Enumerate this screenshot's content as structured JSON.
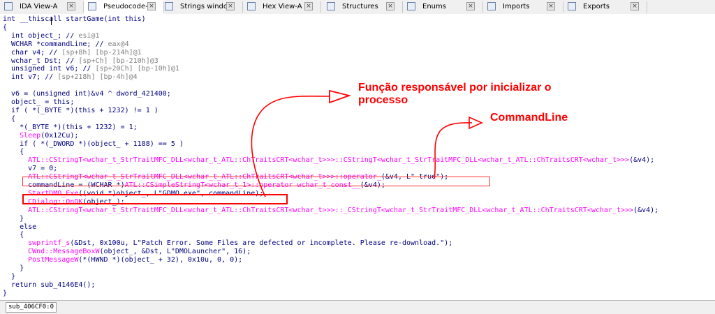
{
  "tabs": [
    {
      "label": "IDA View-A",
      "icon": "ida-view-icon"
    },
    {
      "label": "Pseudocode-A",
      "icon": "pseudocode-icon",
      "active": true
    },
    {
      "label": "Strings window",
      "icon": "strings-icon"
    },
    {
      "label": "Hex View-A",
      "icon": "hex-view-icon"
    },
    {
      "label": "Structures",
      "icon": "structures-icon"
    },
    {
      "label": "Enums",
      "icon": "enums-icon"
    },
    {
      "label": "Imports",
      "icon": "imports-icon"
    },
    {
      "label": "Exports",
      "icon": "exports-icon"
    }
  ],
  "code_lines": [
    [
      [
        "int __thiscall startGame(int this)",
        "c-id"
      ]
    ],
    [
      [
        "{",
        "c-id"
      ]
    ],
    [
      [
        "  int object_; // ",
        "c-id"
      ],
      [
        "esi@1",
        "c-cmt"
      ]
    ],
    [
      [
        "  WCHAR *commandLine; // ",
        "c-id"
      ],
      [
        "eax@4",
        "c-cmt"
      ]
    ],
    [
      [
        "  char v4; // ",
        "c-id"
      ],
      [
        "[sp+8h] [bp-214h]@1",
        "c-cmt"
      ]
    ],
    [
      [
        "  wchar_t Dst; // ",
        "c-id"
      ],
      [
        "[sp+Ch] [bp-210h]@3",
        "c-cmt"
      ]
    ],
    [
      [
        "  unsigned int v6; // ",
        "c-id"
      ],
      [
        "[sp+20Ch] [bp-10h]@1",
        "c-cmt"
      ]
    ],
    [
      [
        "  int v7; // ",
        "c-id"
      ],
      [
        "[sp+218h] [bp-4h]@4",
        "c-cmt"
      ]
    ],
    [
      [
        "",
        "c-id"
      ]
    ],
    [
      [
        "  v6 = (unsigned int)&v4 ^ dword_421400;",
        "c-id"
      ]
    ],
    [
      [
        "  object_ = this;",
        "c-id"
      ]
    ],
    [
      [
        "  if ( *(_BYTE *)(this + 1232) != 1 )",
        "c-id"
      ]
    ],
    [
      [
        "  {",
        "c-id"
      ]
    ],
    [
      [
        "    *(_BYTE *)(this + 1232) = 1;",
        "c-id"
      ]
    ],
    [
      [
        "    ",
        "c-id"
      ],
      [
        "Sleep",
        "c-api"
      ],
      [
        "(0x12Cu);",
        "c-id"
      ]
    ],
    [
      [
        "    if ( *(_DWORD *)(object_ + 1188) == 5 )",
        "c-id"
      ]
    ],
    [
      [
        "    {",
        "c-id"
      ]
    ],
    [
      [
        "      ",
        "c-id"
      ],
      [
        "ATL::CStringT<wchar_t_StrTraitMFC_DLL<wchar_t_ATL::ChTraitsCRT<wchar_t>>>::CStringT<wchar_t_StrTraitMFC_DLL<wchar_t_ATL::ChTraitsCRT<wchar_t>>>",
        "c-api"
      ],
      [
        "(&v4);",
        "c-id"
      ]
    ],
    [
      [
        "      v7 = 0;",
        "c-id"
      ]
    ],
    [
      [
        "      ",
        "c-id"
      ],
      [
        "ATL::CStringT<wchar_t_StrTraitMFC_DLL<wchar_t_ATL::ChTraitsCRT<wchar_t>>>::operator_",
        "c-api"
      ],
      [
        "(&v4, L\" true\");",
        "c-id"
      ]
    ],
    [
      [
        "      commandLine = (WCHAR *)",
        "c-id"
      ],
      [
        "ATL::CSimpleStringT<wchar_t_1>::operator wchar_t_const__",
        "c-api"
      ],
      [
        "(&v4);",
        "c-id"
      ]
    ],
    [
      [
        "      ",
        "c-id"
      ],
      [
        "StartDMO_Exe",
        "c-api"
      ],
      [
        "((void *)object_, L\"GDMO.exe\", commandLine);",
        "c-id"
      ]
    ],
    [
      [
        "      ",
        "c-id"
      ],
      [
        "CDialog::OnOK",
        "c-api"
      ],
      [
        "(object_);",
        "c-id"
      ]
    ],
    [
      [
        "      ",
        "c-id"
      ],
      [
        "ATL::CStringT<wchar_t_StrTraitMFC_DLL<wchar_t_ATL::ChTraitsCRT<wchar_t>>>::_CStringT<wchar_t_StrTraitMFC_DLL<wchar_t_ATL::ChTraitsCRT<wchar_t>>>",
        "c-api"
      ],
      [
        "(&v4);",
        "c-id"
      ]
    ],
    [
      [
        "    }",
        "c-id"
      ]
    ],
    [
      [
        "    else",
        "c-id"
      ]
    ],
    [
      [
        "    {",
        "c-id"
      ]
    ],
    [
      [
        "      ",
        "c-id"
      ],
      [
        "swprintf_s",
        "c-api"
      ],
      [
        "(&Dst, 0x100u, L\"Patch Error. Some Files are defected or incomplete. Please re-download.\");",
        "c-id"
      ]
    ],
    [
      [
        "      ",
        "c-id"
      ],
      [
        "CWnd::MessageBoxW",
        "c-api"
      ],
      [
        "(object_, &Dst, L\"DMOLauncher\", 16);",
        "c-id"
      ]
    ],
    [
      [
        "      ",
        "c-id"
      ],
      [
        "PostMessageW",
        "c-api"
      ],
      [
        "(*(HWND *)(object_ + 32), 0x10u, 0, 0);",
        "c-id"
      ]
    ],
    [
      [
        "    }",
        "c-id"
      ]
    ],
    [
      [
        "  }",
        "c-id"
      ]
    ],
    [
      [
        "  return sub_4146E4();",
        "c-id"
      ]
    ],
    [
      [
        "}",
        "c-id"
      ]
    ]
  ],
  "status": {
    "address": "sub_406CF0:0"
  },
  "annotations": {
    "funcao_line1": "Função responsável por inicializar o",
    "funcao_line2": "processo",
    "commandline": "CommandLine",
    "color": "#ff0000"
  }
}
